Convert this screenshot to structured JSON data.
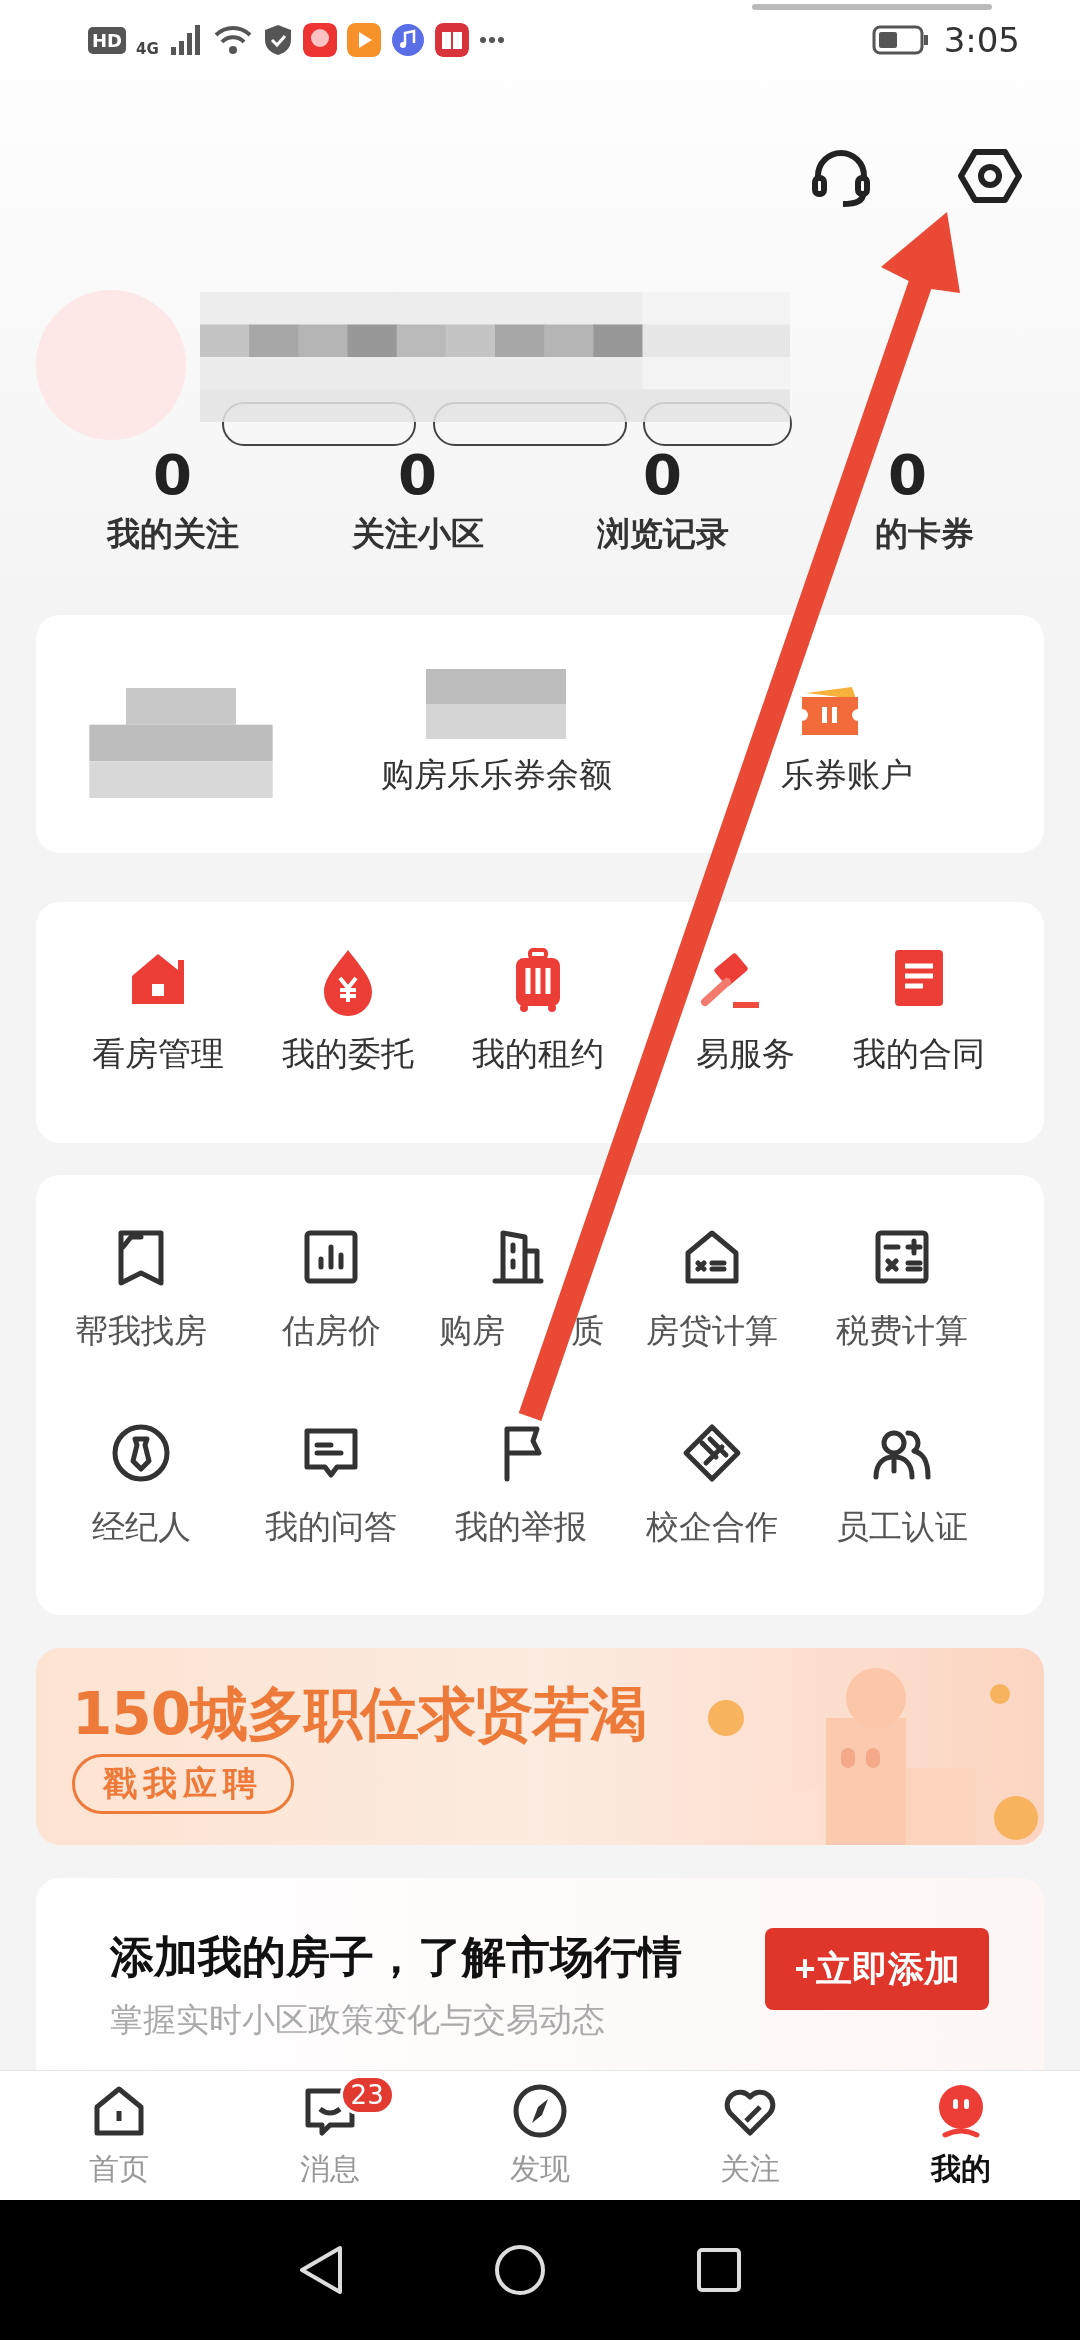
{
  "status_bar": {
    "hd": "HD",
    "network": "4G",
    "time": "3:05"
  },
  "stats": [
    {
      "value": "0",
      "label": "我的关注"
    },
    {
      "value": "0",
      "label": "关注小区"
    },
    {
      "value": "0",
      "label": "浏览记录"
    },
    {
      "value": "0",
      "label": "的卡券",
      "covered_start": true
    }
  ],
  "coupons": [
    {
      "kind": "redacted"
    },
    {
      "kind": "balance",
      "label": "购房乐乐券余额"
    },
    {
      "kind": "account",
      "label": "乐券账户",
      "covered_start": true
    }
  ],
  "services": [
    {
      "label": "看房管理"
    },
    {
      "label": "我的委托"
    },
    {
      "label": "我的租约"
    },
    {
      "label": "易服务",
      "covered_start": true
    },
    {
      "label": "我的合同"
    }
  ],
  "tools": [
    {
      "label": "帮我找房"
    },
    {
      "label": "估房价"
    },
    {
      "label": "购房",
      "label_end": "质"
    },
    {
      "label": "房贷计算"
    },
    {
      "label": "税费计算"
    },
    {
      "label": "经纪人"
    },
    {
      "label": "我的问答"
    },
    {
      "label": "我的举报"
    },
    {
      "label": "校企合作"
    },
    {
      "label": "员工认证"
    }
  ],
  "banner": {
    "title": "150城多职位求贤若渴",
    "button": "戳我应聘"
  },
  "house_card": {
    "title": "添加我的房子，了解市场行情",
    "subtitle": "掌握实时小区政策变化与交易动态",
    "button": "+立即添加"
  },
  "tabs": [
    {
      "label": "首页",
      "selected": false
    },
    {
      "label": "消息",
      "selected": false,
      "badge": "23"
    },
    {
      "label": "发现",
      "selected": false
    },
    {
      "label": "关注",
      "selected": false
    },
    {
      "label": "我的",
      "selected": true
    }
  ]
}
